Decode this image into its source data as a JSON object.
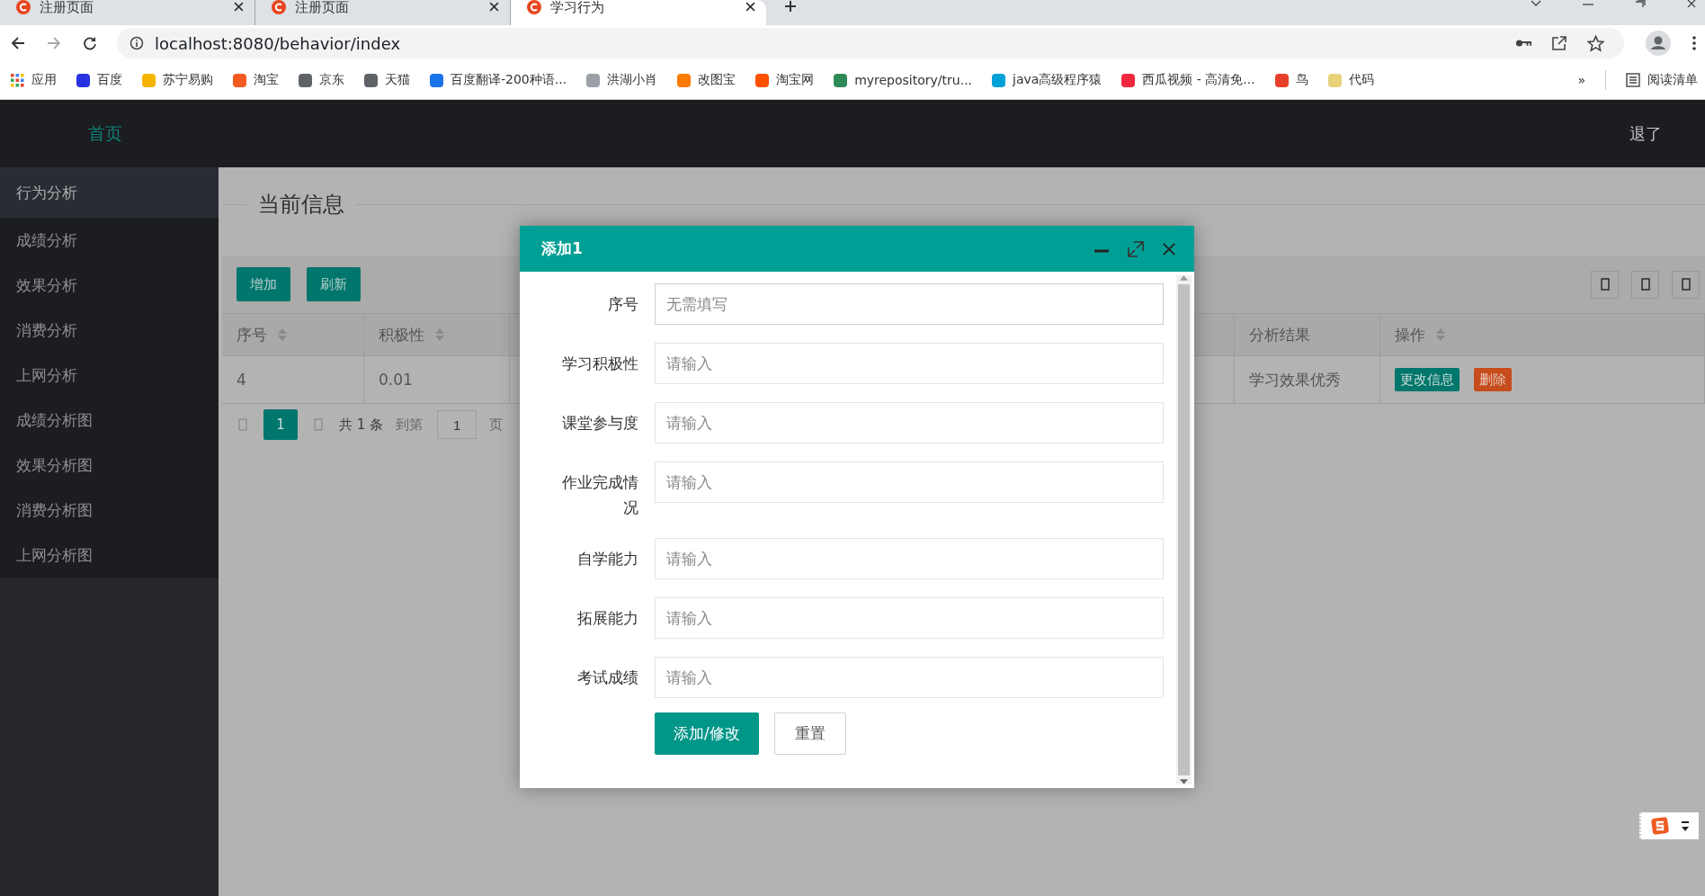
{
  "browser": {
    "tabs": [
      {
        "title": "注册页面",
        "selected": false
      },
      {
        "title": "注册页面",
        "selected": false
      },
      {
        "title": "学习行为",
        "selected": true
      }
    ],
    "address": "localhost:8080/behavior/index",
    "bookmarks": [
      {
        "label": "应用",
        "kind": "apps"
      },
      {
        "label": "百度",
        "kind": "site",
        "color": "#2932e1"
      },
      {
        "label": "苏宁易购",
        "kind": "site",
        "color": "#f5b400"
      },
      {
        "label": "淘宝",
        "kind": "site",
        "color": "#f25a1f"
      },
      {
        "label": "京东",
        "kind": "site",
        "color": "#5f6368"
      },
      {
        "label": "天猫",
        "kind": "site",
        "color": "#5f6368"
      },
      {
        "label": "百度翻译-200种语...",
        "kind": "site",
        "color": "#1a73e8"
      },
      {
        "label": "洪湖小肖",
        "kind": "site",
        "color": "#9aa0a6"
      },
      {
        "label": "改图宝",
        "kind": "site",
        "color": "#ff7a00"
      },
      {
        "label": "淘宝网",
        "kind": "site",
        "color": "#ff5000"
      },
      {
        "label": "myrepository/tru...",
        "kind": "site",
        "color": "#2e8b57"
      },
      {
        "label": "java高级程序猿",
        "kind": "site",
        "color": "#00a1d6"
      },
      {
        "label": "西瓜视频 - 高清免...",
        "kind": "site",
        "color": "#f2273d"
      },
      {
        "label": "鸟",
        "kind": "site",
        "color": "#e8402a"
      },
      {
        "label": "代码",
        "kind": "site",
        "color": "#e8d27a"
      }
    ],
    "overflow": "»",
    "reading_list": "阅读清单"
  },
  "top_nav": {
    "home": "首页",
    "logout": "退了"
  },
  "sidebar": {
    "items": [
      {
        "label": "行为分析",
        "selected": true
      },
      {
        "label": "成绩分析",
        "selected": false
      },
      {
        "label": "效果分析",
        "selected": false
      },
      {
        "label": "消费分析",
        "selected": false
      },
      {
        "label": "上网分析",
        "selected": false
      },
      {
        "label": "成绩分析图",
        "selected": false
      },
      {
        "label": "效果分析图",
        "selected": false
      },
      {
        "label": "消费分析图",
        "selected": false
      },
      {
        "label": "上网分析图",
        "selected": false
      }
    ]
  },
  "main": {
    "section_title": "当前信息",
    "toolbar": [
      "增加",
      "刷新"
    ],
    "table": {
      "columns": [
        {
          "label": "序号",
          "sortable": true
        },
        {
          "label": "积极性",
          "sortable": true
        },
        {
          "label": "分析结果",
          "sortable": false
        },
        {
          "label": "操作",
          "sortable": true
        }
      ],
      "rows": [
        {
          "cells": [
            "4",
            "0.01",
            "学习效果优秀"
          ],
          "actions": [
            {
              "label": "更改信息",
              "kind": "edit"
            },
            {
              "label": "删除",
              "kind": "delete"
            }
          ]
        }
      ]
    },
    "pagination": {
      "pages": [
        {
          "label": "1",
          "selected": true
        }
      ],
      "total": "共 1 条",
      "goto": "到第",
      "page_input": "1",
      "page_unit": "页"
    }
  },
  "dialog": {
    "title": "添加1",
    "fields": [
      {
        "label": "序号",
        "placeholder": "无需填写"
      },
      {
        "label": "学习积极性",
        "placeholder": "请输入"
      },
      {
        "label": "课堂参与度",
        "placeholder": "请输入"
      },
      {
        "label": "作业完成情况",
        "placeholder": "请输入"
      },
      {
        "label": "自学能力",
        "placeholder": "请输入"
      },
      {
        "label": "拓展能力",
        "placeholder": "请输入"
      },
      {
        "label": "考试成绩",
        "placeholder": "请输入"
      }
    ],
    "buttons": [
      {
        "label": "添加/修改",
        "kind": "primary"
      },
      {
        "label": "重置",
        "kind": "plain"
      }
    ]
  }
}
